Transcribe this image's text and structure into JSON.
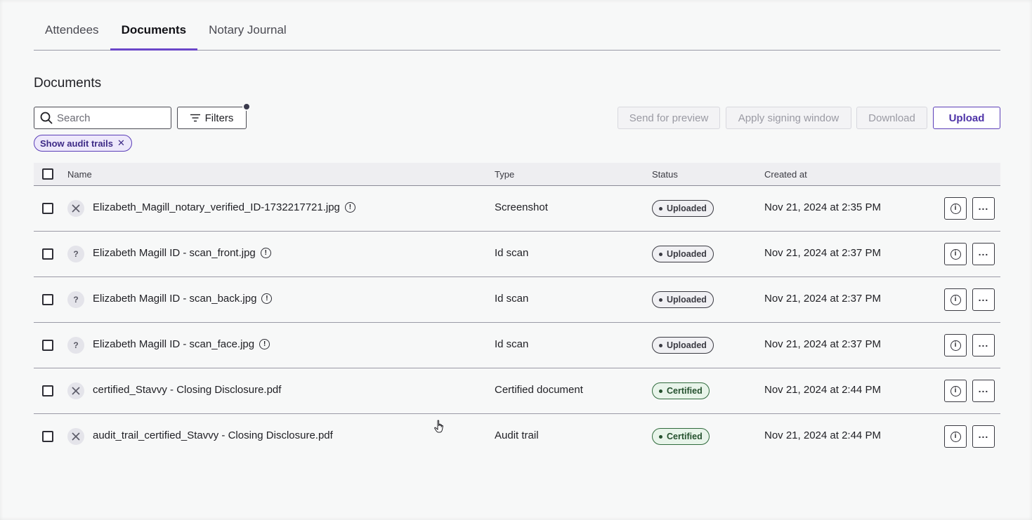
{
  "tabs": [
    {
      "label": "Attendees",
      "active": false
    },
    {
      "label": "Documents",
      "active": true
    },
    {
      "label": "Notary Journal",
      "active": false
    }
  ],
  "page_title": "Documents",
  "toolbar": {
    "search_placeholder": "Search",
    "filters_label": "Filters",
    "send_preview_label": "Send for preview",
    "apply_window_label": "Apply signing window",
    "download_label": "Download",
    "upload_label": "Upload"
  },
  "active_filter_chip": "Show audit trails",
  "table": {
    "columns": [
      "Name",
      "Type",
      "Status",
      "Created at"
    ],
    "rows": [
      {
        "icon": "crossed-icon",
        "name": "Elizabeth_Magill_notary_verified_ID-1732217721.jpg",
        "has_info": true,
        "type": "Screenshot",
        "status": "Uploaded",
        "created": "Nov 21, 2024 at 2:35 PM"
      },
      {
        "icon": "question-icon",
        "name": "Elizabeth Magill ID - scan_front.jpg",
        "has_info": true,
        "type": "Id scan",
        "status": "Uploaded",
        "created": "Nov 21, 2024 at 2:37 PM"
      },
      {
        "icon": "question-icon",
        "name": "Elizabeth Magill ID - scan_back.jpg",
        "has_info": true,
        "type": "Id scan",
        "status": "Uploaded",
        "created": "Nov 21, 2024 at 2:37 PM"
      },
      {
        "icon": "question-icon",
        "name": "Elizabeth Magill ID - scan_face.jpg",
        "has_info": true,
        "type": "Id scan",
        "status": "Uploaded",
        "created": "Nov 21, 2024 at 2:37 PM"
      },
      {
        "icon": "crossed-icon",
        "name": "certified_Stavvy - Closing Disclosure.pdf",
        "has_info": false,
        "type": "Certified document",
        "status": "Certified",
        "created": "Nov 21, 2024 at 2:44 PM"
      },
      {
        "icon": "crossed-icon",
        "name": "audit_trail_certified_Stavvy - Closing Disclosure.pdf",
        "has_info": false,
        "type": "Audit trail",
        "status": "Certified",
        "created": "Nov 21, 2024 at 2:44 PM"
      }
    ]
  },
  "colors": {
    "accent": "#6b47c9",
    "certified": "#2f6a3c"
  }
}
